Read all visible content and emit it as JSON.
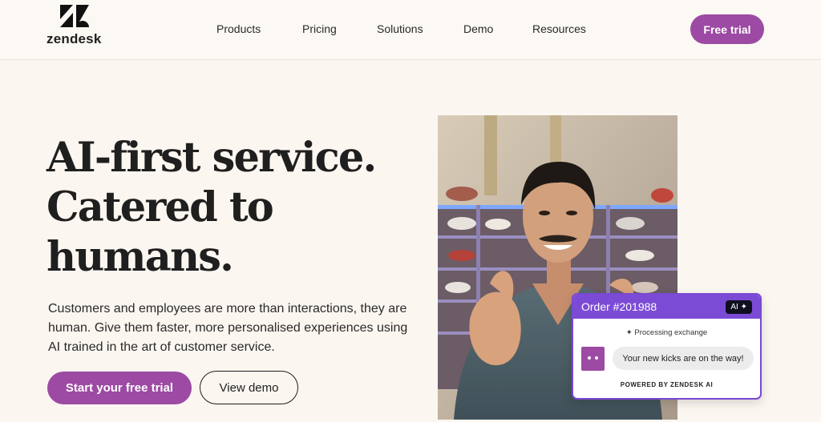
{
  "brand": {
    "name": "zendesk",
    "accent": "#9c4aa3",
    "chat_accent": "#7c4bd6",
    "background": "#fbf6f0"
  },
  "nav": {
    "items": [
      "Products",
      "Pricing",
      "Solutions",
      "Demo",
      "Resources"
    ],
    "cta_label": "Free trial"
  },
  "hero": {
    "headline": "AI-first service. Catered to humans.",
    "body": "Customers and employees are more than interactions, they are human. Give them faster, more personalised experiences using AI trained in the art of customer service.",
    "primary_button": "Start your free trial",
    "secondary_button": "View demo"
  },
  "chat_card": {
    "order": "Order #201988",
    "ai_badge": "AI ✦",
    "processing": "Processing exchange",
    "message": "Your new kicks are on the way!",
    "powered_by": "POWERED BY ZENDESK AI"
  }
}
